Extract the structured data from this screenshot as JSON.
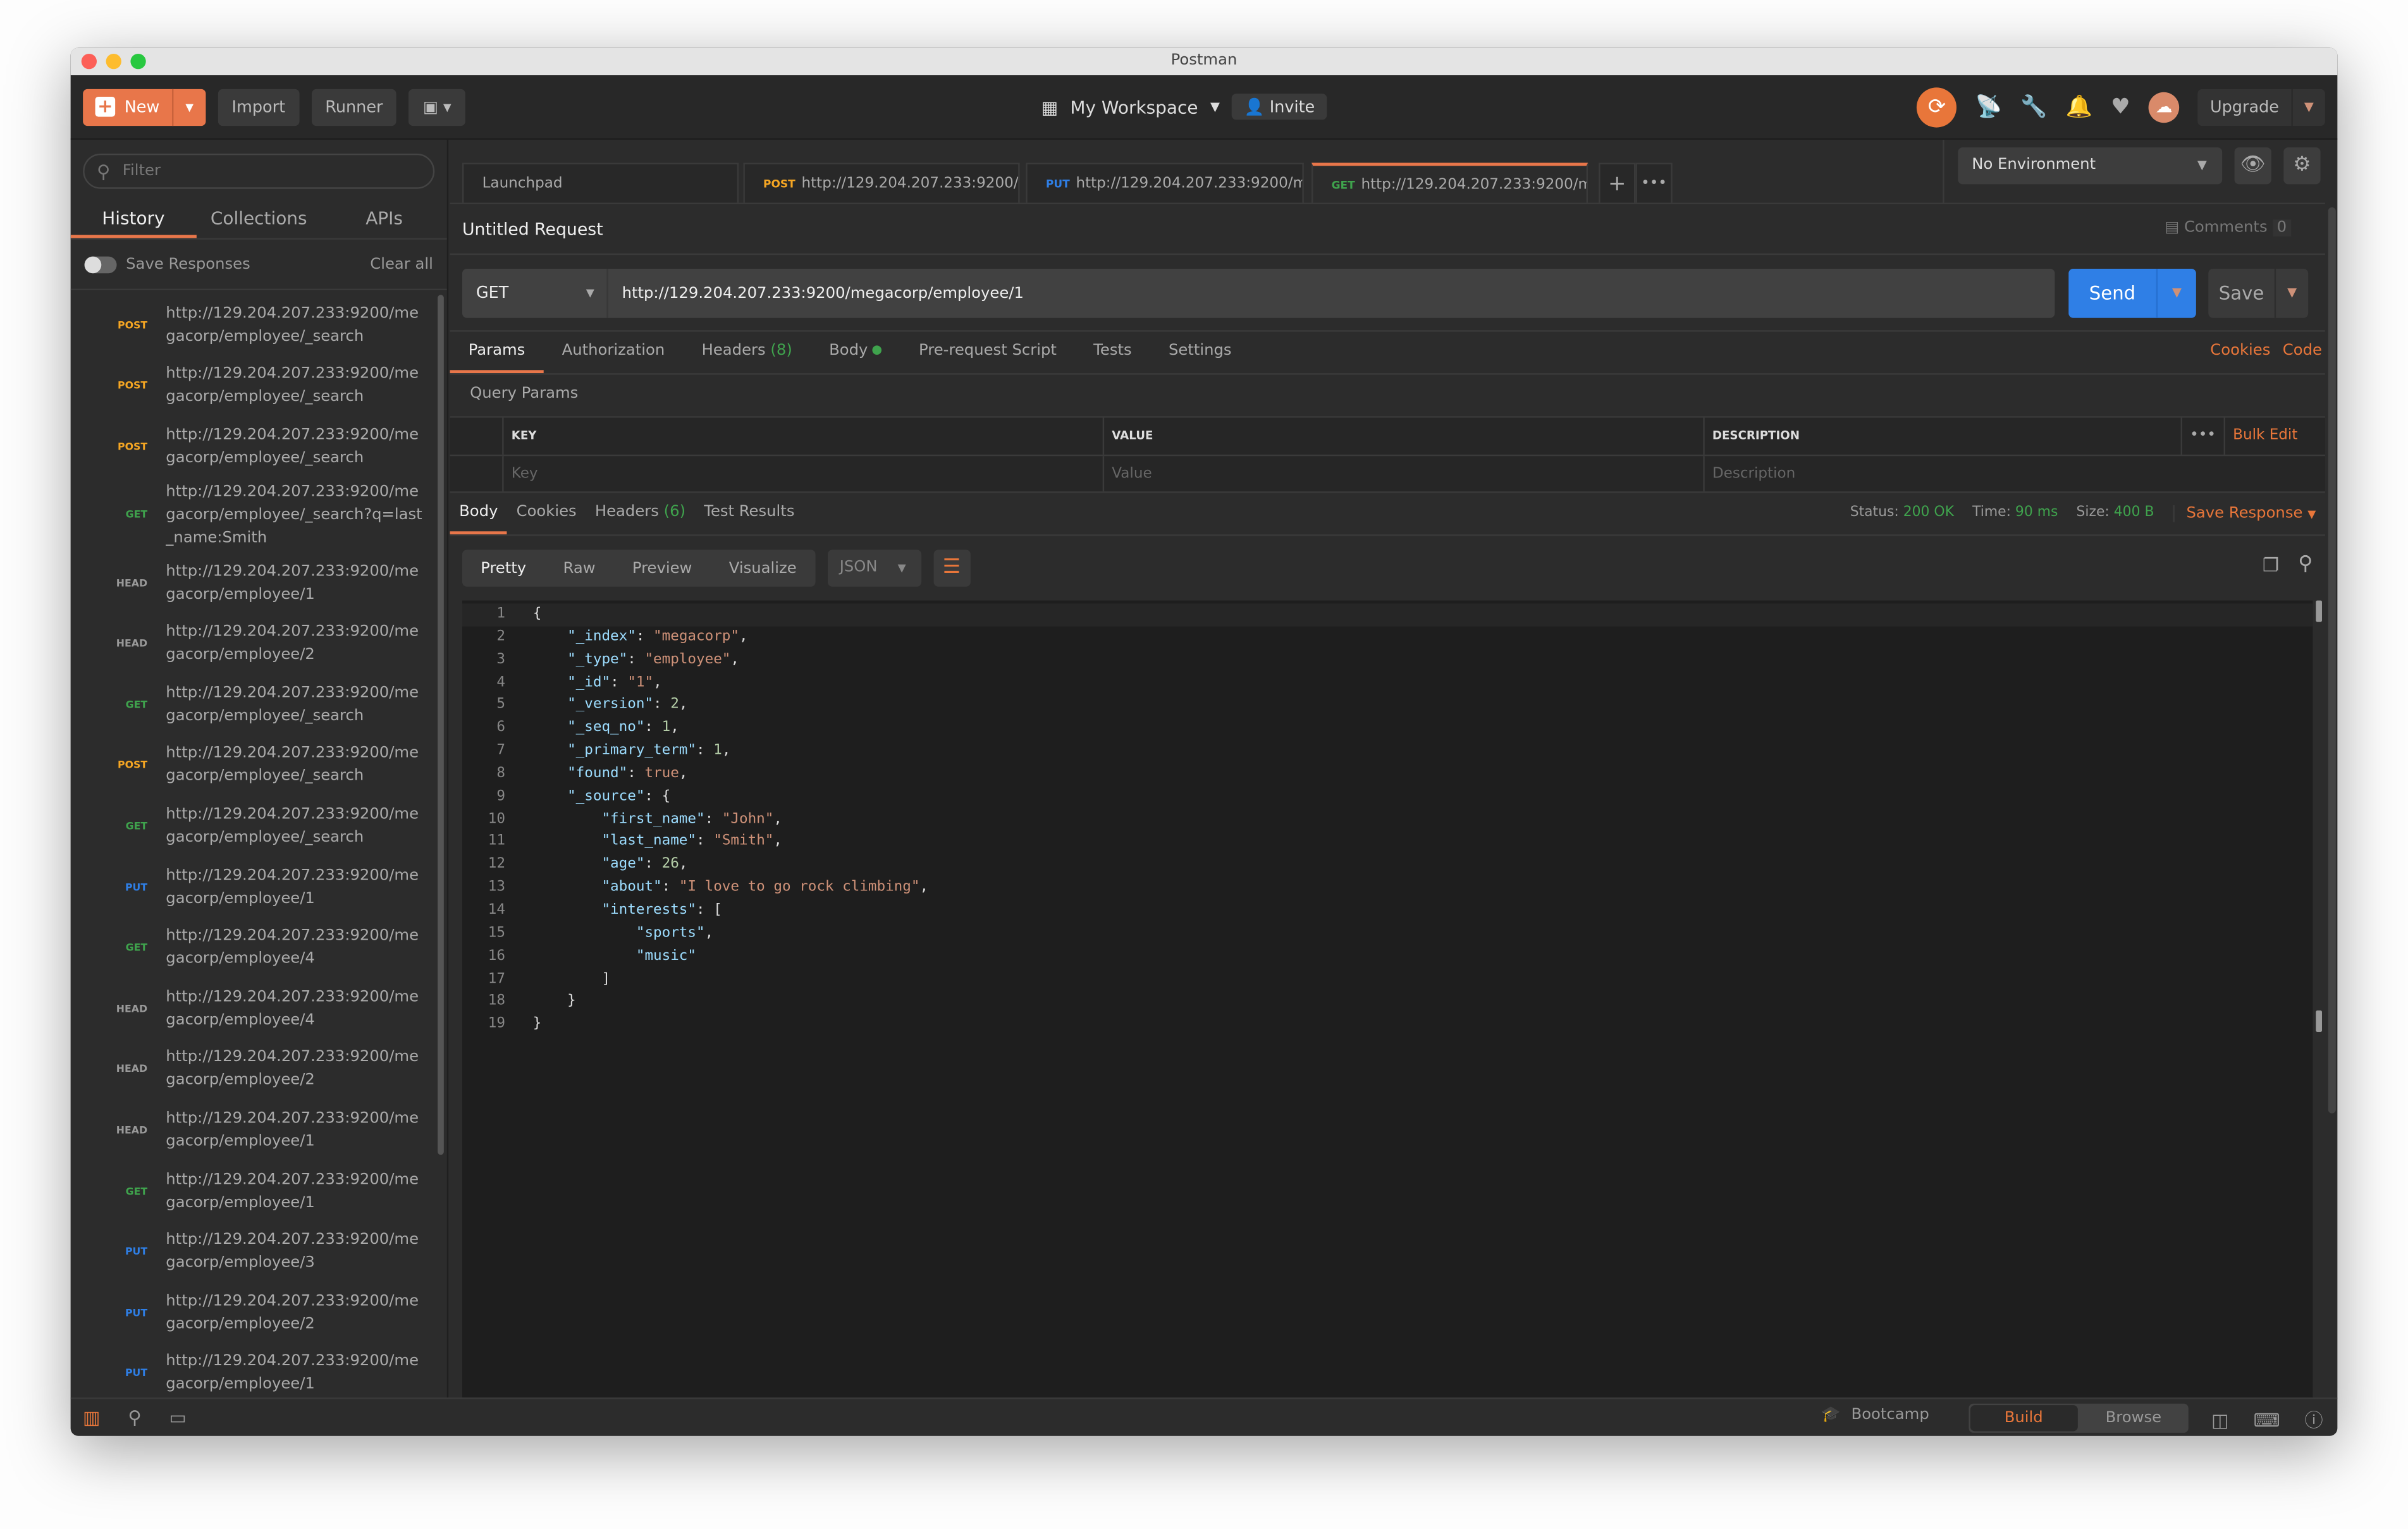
{
  "window": {
    "title": "Postman"
  },
  "header": {
    "new": "New",
    "import": "Import",
    "runner": "Runner",
    "workspace": "My Workspace",
    "invite": "Invite",
    "upgrade": "Upgrade"
  },
  "sidebar": {
    "filter_placeholder": "Filter",
    "tabs": [
      "History",
      "Collections",
      "APIs"
    ],
    "save_responses": "Save Responses",
    "clear_all": "Clear all",
    "items": [
      {
        "method": "POST",
        "url": "http://129.204.207.233:9200/megacorp/employee/_search"
      },
      {
        "method": "POST",
        "url": "http://129.204.207.233:9200/megacorp/employee/_search"
      },
      {
        "method": "POST",
        "url": "http://129.204.207.233:9200/megacorp/employee/_search"
      },
      {
        "method": "GET",
        "url": "http://129.204.207.233:9200/megacorp/employee/_search?q=last_name:Smith"
      },
      {
        "method": "HEAD",
        "url": "http://129.204.207.233:9200/megacorp/employee/1"
      },
      {
        "method": "HEAD",
        "url": "http://129.204.207.233:9200/megacorp/employee/2"
      },
      {
        "method": "GET",
        "url": "http://129.204.207.233:9200/megacorp/employee/_search"
      },
      {
        "method": "POST",
        "url": "http://129.204.207.233:9200/megacorp/employee/_search"
      },
      {
        "method": "GET",
        "url": "http://129.204.207.233:9200/megacorp/employee/_search"
      },
      {
        "method": "PUT",
        "url": "http://129.204.207.233:9200/megacorp/employee/1"
      },
      {
        "method": "GET",
        "url": "http://129.204.207.233:9200/megacorp/employee/4"
      },
      {
        "method": "HEAD",
        "url": "http://129.204.207.233:9200/megacorp/employee/4"
      },
      {
        "method": "HEAD",
        "url": "http://129.204.207.233:9200/megacorp/employee/2"
      },
      {
        "method": "HEAD",
        "url": "http://129.204.207.233:9200/megacorp/employee/1"
      },
      {
        "method": "GET",
        "url": "http://129.204.207.233:9200/megacorp/employee/1"
      },
      {
        "method": "PUT",
        "url": "http://129.204.207.233:9200/megacorp/employee/3"
      },
      {
        "method": "PUT",
        "url": "http://129.204.207.233:9200/megacorp/employee/2"
      },
      {
        "method": "PUT",
        "url": "http://129.204.207.233:9200/megacorp/employee/1"
      }
    ]
  },
  "method_colors": {
    "POST": "#f5a623",
    "GET": "#3fa34d",
    "PUT": "#2f7fe6",
    "HEAD": "#999999"
  },
  "request_tabs": [
    {
      "label": "Launchpad",
      "method": "",
      "dot": false
    },
    {
      "label": "http://129.204.207.233:9200/...",
      "method": "POST",
      "dot": true
    },
    {
      "label": "http://129.204.207.233:9200/m...",
      "method": "PUT",
      "dot": true
    },
    {
      "label": "http://129.204.207.233:9200/m...",
      "method": "GET",
      "dot": true,
      "active": true
    }
  ],
  "environment": "No Environment",
  "request": {
    "title": "Untitled Request",
    "comments": "Comments",
    "comments_count": "0",
    "method": "GET",
    "url": "http://129.204.207.233:9200/megacorp/employee/1",
    "send": "Send",
    "save": "Save",
    "tabs": [
      "Params",
      "Authorization",
      "Headers",
      "Body",
      "Pre-request Script",
      "Tests",
      "Settings"
    ],
    "headers_count": "(8)",
    "cookies": "Cookies",
    "code": "Code",
    "query_params": "Query Params",
    "columns": [
      "KEY",
      "VALUE",
      "DESCRIPTION"
    ],
    "bulk_edit": "Bulk Edit",
    "placeholders": [
      "Key",
      "Value",
      "Description"
    ]
  },
  "response": {
    "tabs": [
      "Body",
      "Cookies",
      "Headers",
      "Test Results"
    ],
    "headers_count": "(6)",
    "status_label": "Status:",
    "status": "200 OK",
    "time_label": "Time:",
    "time": "90 ms",
    "size_label": "Size:",
    "size": "400 B",
    "save_response": "Save Response",
    "formats": [
      "Pretty",
      "Raw",
      "Preview",
      "Visualize"
    ],
    "language": "JSON",
    "lines": [
      [
        [
          "p",
          "{"
        ]
      ],
      [
        [
          "p",
          "    "
        ],
        [
          "k",
          "\"_index\""
        ],
        [
          "p",
          ": "
        ],
        [
          "s",
          "\"megacorp\""
        ],
        [
          "p",
          ","
        ]
      ],
      [
        [
          "p",
          "    "
        ],
        [
          "k",
          "\"_type\""
        ],
        [
          "p",
          ": "
        ],
        [
          "s",
          "\"employee\""
        ],
        [
          "p",
          ","
        ]
      ],
      [
        [
          "p",
          "    "
        ],
        [
          "k",
          "\"_id\""
        ],
        [
          "p",
          ": "
        ],
        [
          "s",
          "\"1\""
        ],
        [
          "p",
          ","
        ]
      ],
      [
        [
          "p",
          "    "
        ],
        [
          "k",
          "\"_version\""
        ],
        [
          "p",
          ": "
        ],
        [
          "num",
          "2"
        ],
        [
          "p",
          ","
        ]
      ],
      [
        [
          "p",
          "    "
        ],
        [
          "k",
          "\"_seq_no\""
        ],
        [
          "p",
          ": "
        ],
        [
          "num",
          "1"
        ],
        [
          "p",
          ","
        ]
      ],
      [
        [
          "p",
          "    "
        ],
        [
          "k",
          "\"_primary_term\""
        ],
        [
          "p",
          ": "
        ],
        [
          "num",
          "1"
        ],
        [
          "p",
          ","
        ]
      ],
      [
        [
          "p",
          "    "
        ],
        [
          "k",
          "\"found\""
        ],
        [
          "p",
          ": "
        ],
        [
          "b",
          "true"
        ],
        [
          "p",
          ","
        ]
      ],
      [
        [
          "p",
          "    "
        ],
        [
          "k",
          "\"_source\""
        ],
        [
          "p",
          ": {"
        ]
      ],
      [
        [
          "p",
          "        "
        ],
        [
          "k",
          "\"first_name\""
        ],
        [
          "p",
          ": "
        ],
        [
          "s",
          "\"John\""
        ],
        [
          "p",
          ","
        ]
      ],
      [
        [
          "p",
          "        "
        ],
        [
          "k",
          "\"last_name\""
        ],
        [
          "p",
          ": "
        ],
        [
          "s",
          "\"Smith\""
        ],
        [
          "p",
          ","
        ]
      ],
      [
        [
          "p",
          "        "
        ],
        [
          "k",
          "\"age\""
        ],
        [
          "p",
          ": "
        ],
        [
          "num",
          "26"
        ],
        [
          "p",
          ","
        ]
      ],
      [
        [
          "p",
          "        "
        ],
        [
          "k",
          "\"about\""
        ],
        [
          "p",
          ": "
        ],
        [
          "s",
          "\"I love to go rock climbing\""
        ],
        [
          "p",
          ","
        ]
      ],
      [
        [
          "p",
          "        "
        ],
        [
          "k",
          "\"interests\""
        ],
        [
          "p",
          ": ["
        ]
      ],
      [
        [
          "p",
          "            "
        ],
        [
          "k",
          "\"sports\""
        ],
        [
          "p",
          ","
        ]
      ],
      [
        [
          "p",
          "            "
        ],
        [
          "k",
          "\"music\""
        ]
      ],
      [
        [
          "p",
          "        ]"
        ]
      ],
      [
        [
          "p",
          "    }"
        ]
      ],
      [
        [
          "p",
          "}"
        ]
      ]
    ]
  },
  "footer": {
    "bootcamp": "Bootcamp",
    "build": "Build",
    "browse": "Browse"
  }
}
